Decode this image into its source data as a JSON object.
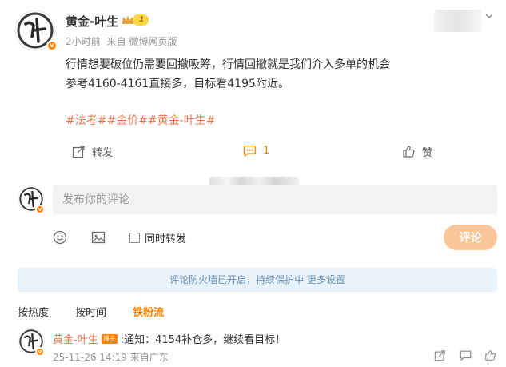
{
  "post": {
    "author": "黄金-叶生",
    "level": "1",
    "time": "2小时前",
    "source_prefix": "来自",
    "source": "微博网页版",
    "text_line1": "行情想要破位仍需要回撤吸筹，行情回撤就是我们介入多单的机会",
    "text_line2": "参考4160-4161直接多，目标看4195附近。",
    "tags": "#法考##金价##黄金-叶生#",
    "avatar_char": "叶"
  },
  "actions": {
    "repost_label": "转发",
    "comment_count": "1",
    "like_label": "赞"
  },
  "composer": {
    "placeholder": "发布你的评论",
    "repost_option": "同时转发",
    "submit_label": "评论"
  },
  "notice": "评论防火墙已开启，持续保护中 更多设置",
  "sort_tabs": [
    {
      "label": "按热度"
    },
    {
      "label": "按时间"
    },
    {
      "label": "铁粉流"
    }
  ],
  "comments": [
    {
      "author": "黄金-叶生",
      "badge": "博主",
      "text": ":通知：4154补仓多，继续看目标！",
      "date": "25-11-26 14:19",
      "location": "来自广东"
    }
  ],
  "colors": {
    "accent": "#ff8200",
    "tag": "#eb7350",
    "notice_bg": "#e8f3fc",
    "submit_bg": "#fbc79a"
  }
}
